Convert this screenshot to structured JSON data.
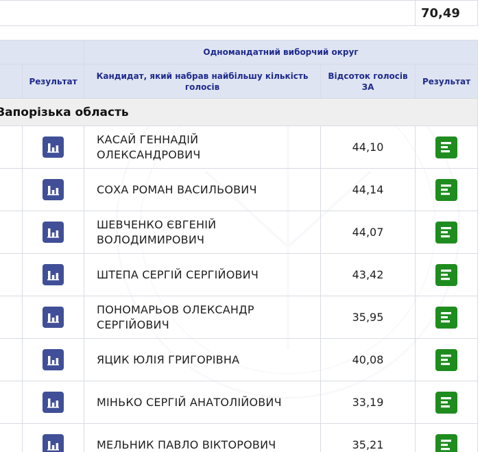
{
  "total": {
    "value": "70,49"
  },
  "header": {
    "district_group": "Одномандатний виборчий округ",
    "left_result": "Результат",
    "candidate": "Кандидат, який набрав найбільшу кількість голосів",
    "percent": "Відсоток голосів ЗА",
    "result": "Результат"
  },
  "region": {
    "name": "Запорізька область"
  },
  "icons": {
    "stats": "bar-chart-icon",
    "result": "result-list-icon",
    "stats_color": "#404f97",
    "result_color": "#1e8c1e"
  },
  "rows": [
    {
      "candidate_line1": "КАСАЙ ГЕННАДІЙ",
      "candidate_line2": "ОЛЕКСАНДРОВИЧ",
      "percent": "44,10"
    },
    {
      "candidate_line1": "СОХА РОМАН ВАСИЛЬОВИЧ",
      "candidate_line2": "",
      "percent": "44,14"
    },
    {
      "candidate_line1": "ШЕВЧЕНКО ЄВГЕНІЙ",
      "candidate_line2": "ВОЛОДИМИРОВИЧ",
      "percent": "44,07"
    },
    {
      "candidate_line1": "ШТЕПА СЕРГІЙ СЕРГІЙОВИЧ",
      "candidate_line2": "",
      "percent": "43,42"
    },
    {
      "candidate_line1": "ПОНОМАРЬОВ ОЛЕКСАНДР",
      "candidate_line2": "СЕРГІЙОВИЧ",
      "percent": "35,95"
    },
    {
      "candidate_line1": "ЯЦИК ЮЛІЯ ГРИГОРІВНА",
      "candidate_line2": "",
      "percent": "40,08"
    },
    {
      "candidate_line1": "МІНЬКО СЕРГІЙ АНАТОЛІЙОВИЧ",
      "candidate_line2": "",
      "percent": "33,19"
    },
    {
      "candidate_line1": "МЕЛЬНИК ПАВЛО ВІКТОРОВИЧ",
      "candidate_line2": "",
      "percent": "35,21"
    }
  ]
}
